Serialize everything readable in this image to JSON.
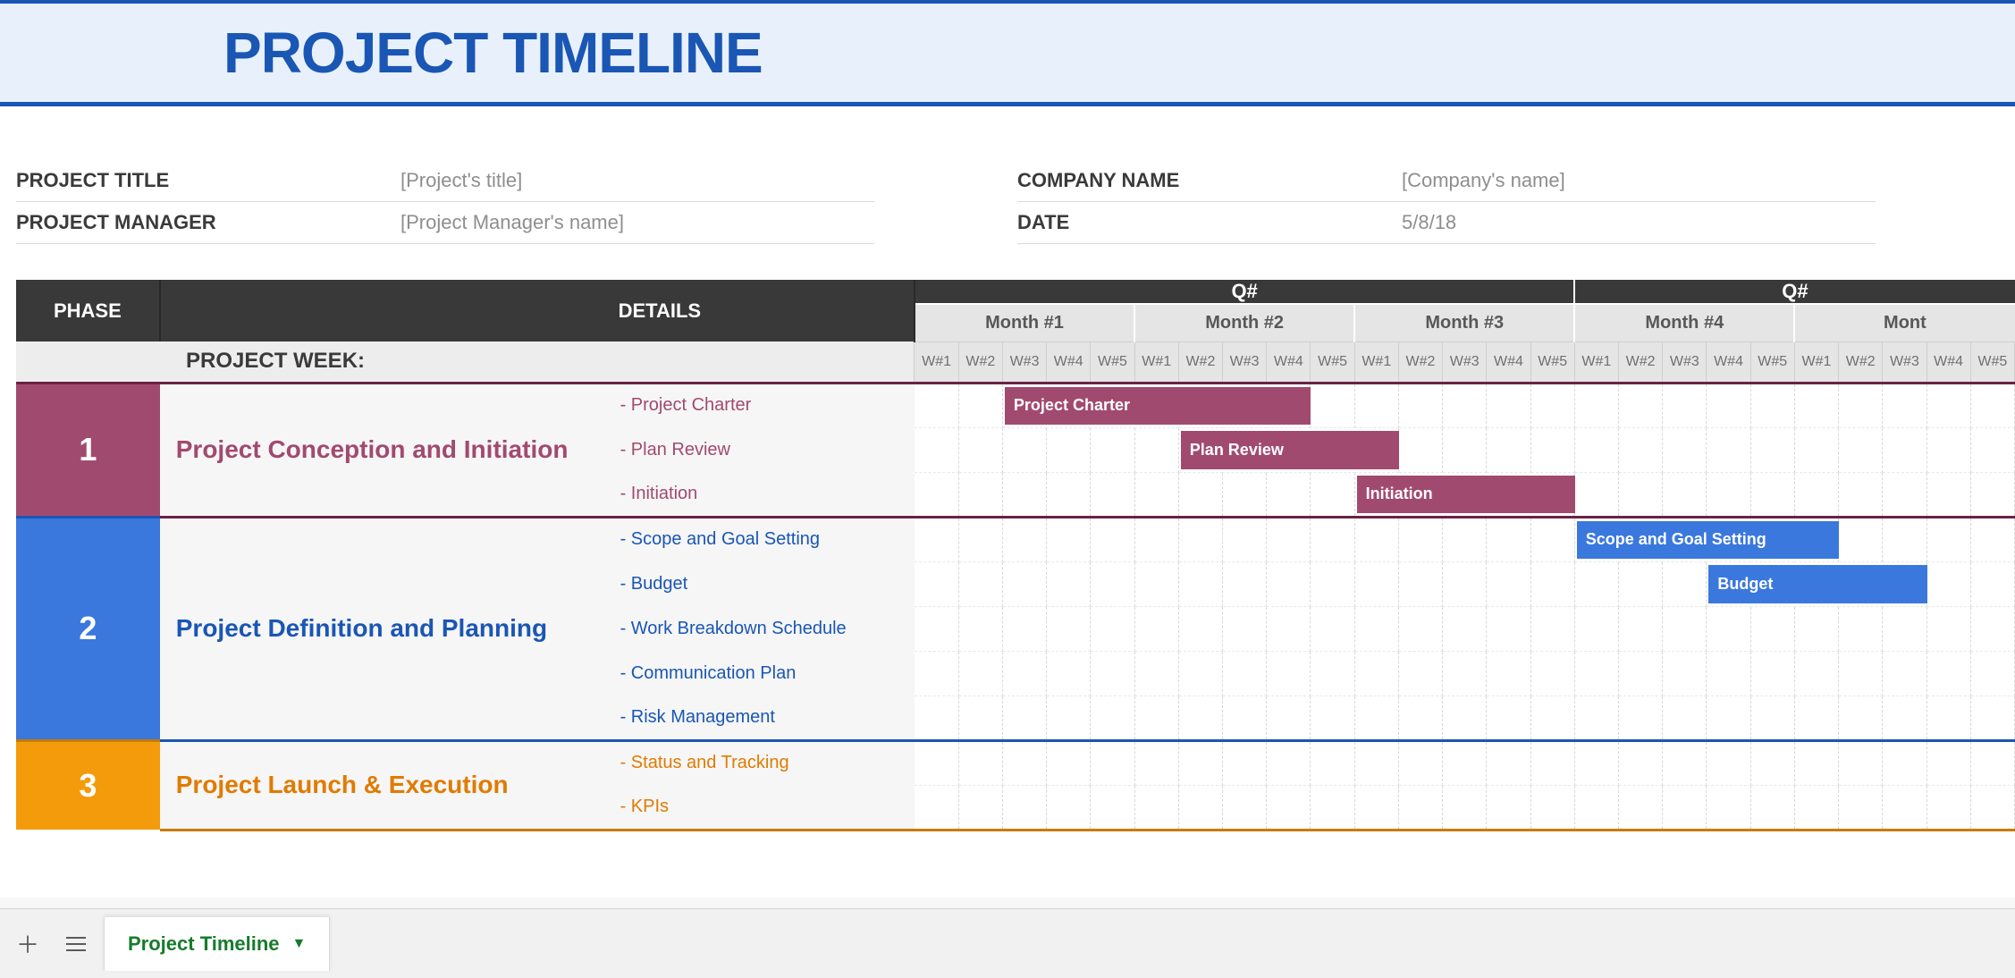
{
  "title": "PROJECT TIMELINE",
  "meta": {
    "project_title_label": "PROJECT TITLE",
    "project_title_value": "[Project's title]",
    "project_manager_label": "PROJECT MANAGER",
    "project_manager_value": "[Project Manager's name]",
    "company_name_label": "COMPANY NAME",
    "company_name_value": "[Company's name]",
    "date_label": "DATE",
    "date_value": "5/8/18"
  },
  "headers": {
    "phase": "PHASE",
    "details": "DETAILS",
    "project_week": "PROJECT WEEK:",
    "quarter": "Q#",
    "quarter2": "Q#",
    "months": [
      "Month #1",
      "Month #2",
      "Month #3",
      "Month #4",
      "Mont"
    ],
    "week_prefix": "W#"
  },
  "phases": [
    {
      "num": "1",
      "name": "Project Conception and Initiation",
      "color": "maroon",
      "details": [
        "- Project Charter",
        "- Plan Review",
        "- Initiation"
      ]
    },
    {
      "num": "2",
      "name": "Project Definition and Planning",
      "color": "blue",
      "details": [
        "- Scope and Goal Setting",
        "- Budget",
        "- Work Breakdown Schedule",
        "- Communication Plan",
        "- Risk Management"
      ]
    },
    {
      "num": "3",
      "name": "Project Launch & Execution",
      "color": "orange",
      "details": [
        "- Status and Tracking",
        "- KPIs"
      ]
    }
  ],
  "bars": [
    {
      "row": 0,
      "start": 2,
      "span": 7,
      "label": "Project Charter",
      "color": "maroon"
    },
    {
      "row": 1,
      "start": 6,
      "span": 5,
      "label": "Plan Review",
      "color": "maroon"
    },
    {
      "row": 2,
      "start": 10,
      "span": 5,
      "label": "Initiation",
      "color": "maroon"
    },
    {
      "row": 3,
      "start": 15,
      "span": 6,
      "label": "Scope and Goal Setting",
      "color": "blue"
    },
    {
      "row": 4,
      "start": 18,
      "span": 5,
      "label": "Budget",
      "color": "blue"
    }
  ],
  "sheet_tab": "Project Timeline",
  "chart_data": {
    "type": "gantt",
    "columns_per_month": 5,
    "visible_months": 5,
    "quarters": [
      "Q#",
      "Q#"
    ],
    "tasks": [
      {
        "phase": 1,
        "name": "Project Charter",
        "start_week_index": 2,
        "duration_weeks": 7
      },
      {
        "phase": 1,
        "name": "Plan Review",
        "start_week_index": 6,
        "duration_weeks": 5
      },
      {
        "phase": 1,
        "name": "Initiation",
        "start_week_index": 10,
        "duration_weeks": 5
      },
      {
        "phase": 2,
        "name": "Scope and Goal Setting",
        "start_week_index": 15,
        "duration_weeks": 6
      },
      {
        "phase": 2,
        "name": "Budget",
        "start_week_index": 18,
        "duration_weeks": 5
      }
    ]
  }
}
